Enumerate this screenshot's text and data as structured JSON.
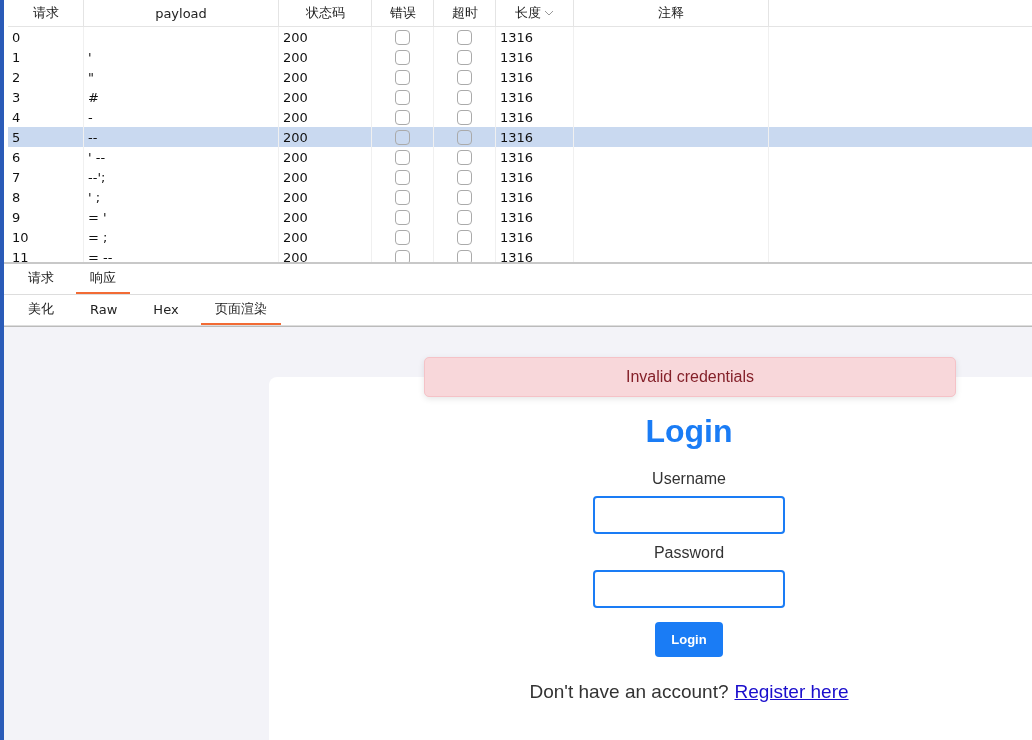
{
  "table": {
    "columns": [
      {
        "label": "请求",
        "sorted": false
      },
      {
        "label": "payload",
        "sorted": false
      },
      {
        "label": "状态码",
        "sorted": false
      },
      {
        "label": "错误",
        "sorted": false
      },
      {
        "label": "超时",
        "sorted": false
      },
      {
        "label": "长度",
        "sorted": true
      },
      {
        "label": "注释",
        "sorted": false
      }
    ],
    "rows": [
      {
        "request": "0",
        "payload": "",
        "status": "200",
        "error": false,
        "timeout": false,
        "length": "1316",
        "selected": false
      },
      {
        "request": "1",
        "payload": "'",
        "status": "200",
        "error": false,
        "timeout": false,
        "length": "1316",
        "selected": false
      },
      {
        "request": "2",
        "payload": "\"",
        "status": "200",
        "error": false,
        "timeout": false,
        "length": "1316",
        "selected": false
      },
      {
        "request": "3",
        "payload": "#",
        "status": "200",
        "error": false,
        "timeout": false,
        "length": "1316",
        "selected": false
      },
      {
        "request": "4",
        "payload": "-",
        "status": "200",
        "error": false,
        "timeout": false,
        "length": "1316",
        "selected": false
      },
      {
        "request": "5",
        "payload": "--",
        "status": "200",
        "error": false,
        "timeout": false,
        "length": "1316",
        "selected": true
      },
      {
        "request": "6",
        "payload": "' --",
        "status": "200",
        "error": false,
        "timeout": false,
        "length": "1316",
        "selected": false
      },
      {
        "request": "7",
        "payload": "--';",
        "status": "200",
        "error": false,
        "timeout": false,
        "length": "1316",
        "selected": false
      },
      {
        "request": "8",
        "payload": "' ;",
        "status": "200",
        "error": false,
        "timeout": false,
        "length": "1316",
        "selected": false
      },
      {
        "request": "9",
        "payload": "= '",
        "status": "200",
        "error": false,
        "timeout": false,
        "length": "1316",
        "selected": false
      },
      {
        "request": "10",
        "payload": "= ;",
        "status": "200",
        "error": false,
        "timeout": false,
        "length": "1316",
        "selected": false
      },
      {
        "request": "11",
        "payload": "= --",
        "status": "200",
        "error": false,
        "timeout": false,
        "length": "1316",
        "selected": false
      }
    ]
  },
  "tabs": [
    {
      "label": "请求",
      "selected": false
    },
    {
      "label": "响应",
      "selected": true
    }
  ],
  "view_tabs": [
    {
      "label": "美化",
      "selected": false
    },
    {
      "label": "Raw",
      "selected": false
    },
    {
      "label": "Hex",
      "selected": false
    },
    {
      "label": "页面渲染",
      "selected": true
    }
  ],
  "render": {
    "alert": "Invalid credentials",
    "title": "Login",
    "username_label": "Username",
    "password_label": "Password",
    "button": "Login",
    "footer_text": "Don't have an account?",
    "footer_link": "Register here"
  }
}
